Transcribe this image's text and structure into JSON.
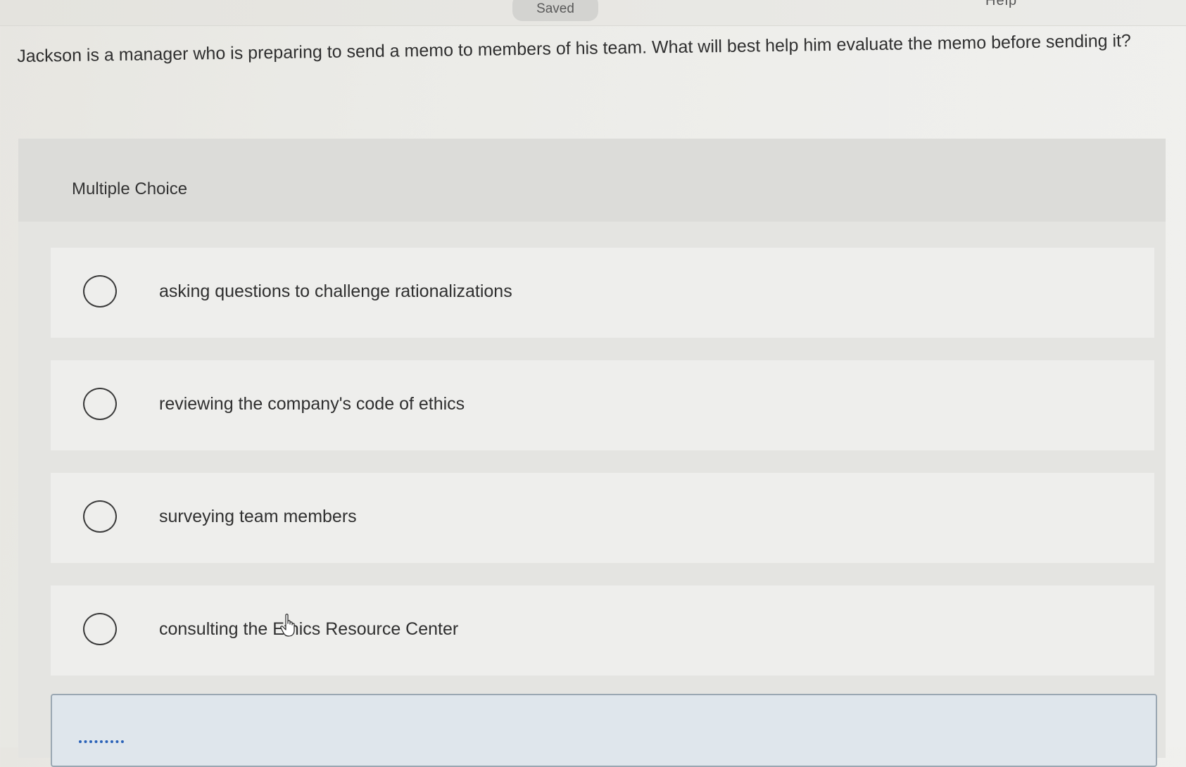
{
  "header": {
    "status": "Saved",
    "right_fragment": "Help"
  },
  "question": {
    "text": "Jackson is a manager who is preparing to send a memo to members of his team. What will best help him evaluate the memo before sending it?"
  },
  "multiple_choice": {
    "title": "Multiple Choice",
    "options": [
      {
        "label": "asking questions to challenge rationalizations"
      },
      {
        "label": "reviewing the company's code of ethics"
      },
      {
        "label": "surveying team members"
      },
      {
        "label": "consulting the Ethics Resource Center"
      }
    ]
  }
}
